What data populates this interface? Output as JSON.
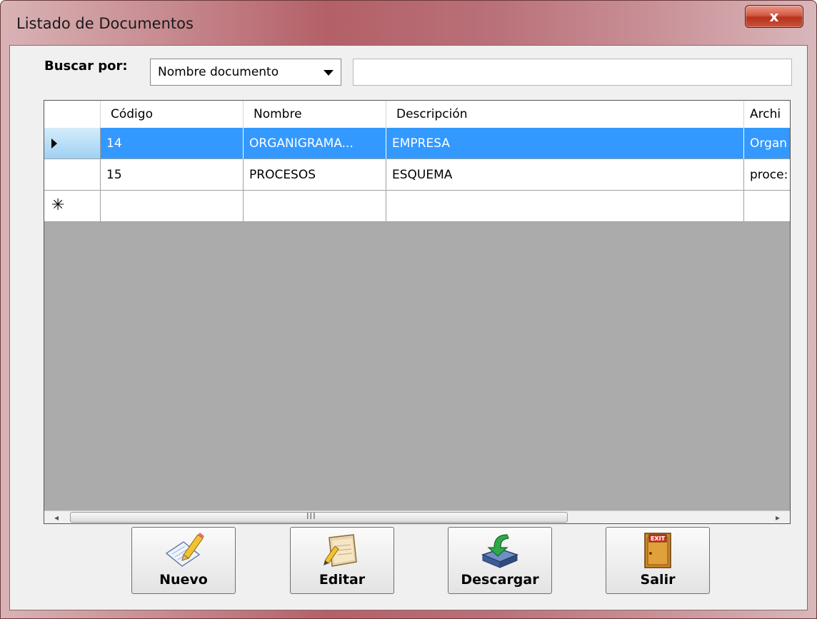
{
  "window": {
    "title": "Listado de Documentos",
    "close_label": "x"
  },
  "search": {
    "label": "Buscar por:",
    "selected": "Nombre documento",
    "text_value": ""
  },
  "grid": {
    "columns": [
      "Código",
      "Nombre",
      "Descripción",
      "Archi"
    ],
    "rows": [
      {
        "codigo": "14",
        "nombre": "ORGANIGRAMA...",
        "descripcion": "EMPRESA",
        "archivo": "Organ"
      },
      {
        "codigo": "15",
        "nombre": "PROCESOS",
        "descripcion": "ESQUEMA",
        "archivo": "proce:"
      }
    ],
    "new_row_marker": "✳",
    "scrollbar": {
      "left_arrow": "◂",
      "right_arrow": "▸",
      "grip": "III"
    }
  },
  "buttons": {
    "nuevo": {
      "label": "Nuevo",
      "icon": "new-document-pencil-icon"
    },
    "editar": {
      "label": "Editar",
      "icon": "edit-notebook-icon"
    },
    "descargar": {
      "label": "Descargar",
      "icon": "download-drive-icon"
    },
    "salir": {
      "label": "Salir",
      "icon": "exit-door-icon"
    }
  },
  "colors": {
    "selection": "#3399ff",
    "grid_background": "#ababab",
    "titlebar": "#b46068"
  }
}
